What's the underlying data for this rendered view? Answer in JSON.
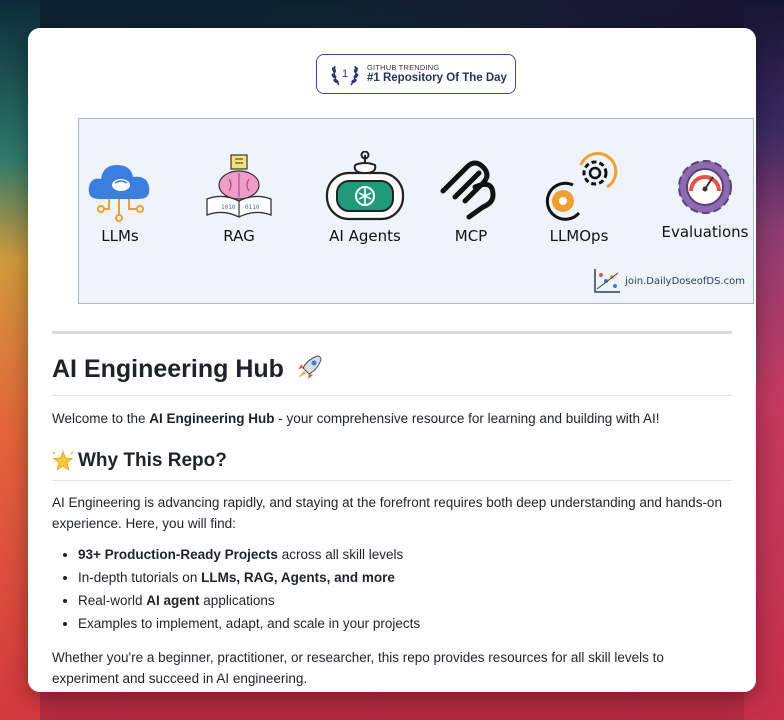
{
  "badge": {
    "rank": "1",
    "small_text": "GITHUB TRENDING",
    "big_text": "#1 Repository Of The Day"
  },
  "banner": {
    "features": [
      {
        "label": "LLMs",
        "icon": "cloud-chip-icon"
      },
      {
        "label": "RAG",
        "icon": "brain-book-icon"
      },
      {
        "label": "AI Agents",
        "icon": "robot-icon"
      },
      {
        "label": "MCP",
        "icon": "mcp-logo-icon"
      },
      {
        "label": "LLMOps",
        "icon": "gears-icon"
      },
      {
        "label": "Evaluations",
        "icon": "gauge-gear-icon"
      }
    ],
    "site": "join.DailyDoseofDS.com"
  },
  "title": "AI Engineering Hub",
  "welcome": {
    "pre": "Welcome to the ",
    "bold": "AI Engineering Hub",
    "post": " - your comprehensive resource for learning and building with AI!"
  },
  "why_heading": "Why This Repo?",
  "intro": "AI Engineering is advancing rapidly, and staying at the forefront requires both deep understanding and hands-on experience. Here, you will find:",
  "list": [
    {
      "pre": "",
      "bold": "93+ Production-Ready Projects",
      "post": " across all skill levels"
    },
    {
      "pre": "In-depth tutorials on ",
      "bold": "LLMs, RAG, Agents, and more",
      "post": ""
    },
    {
      "pre": "Real-world ",
      "bold": "AI agent",
      "post": " applications"
    },
    {
      "pre": "Examples to implement, adapt, and scale in your projects",
      "bold": "",
      "post": ""
    }
  ],
  "closing": "Whether you're a beginner, practitioner, or researcher, this repo provides resources for all skill levels to experiment and succeed in AI engineering."
}
